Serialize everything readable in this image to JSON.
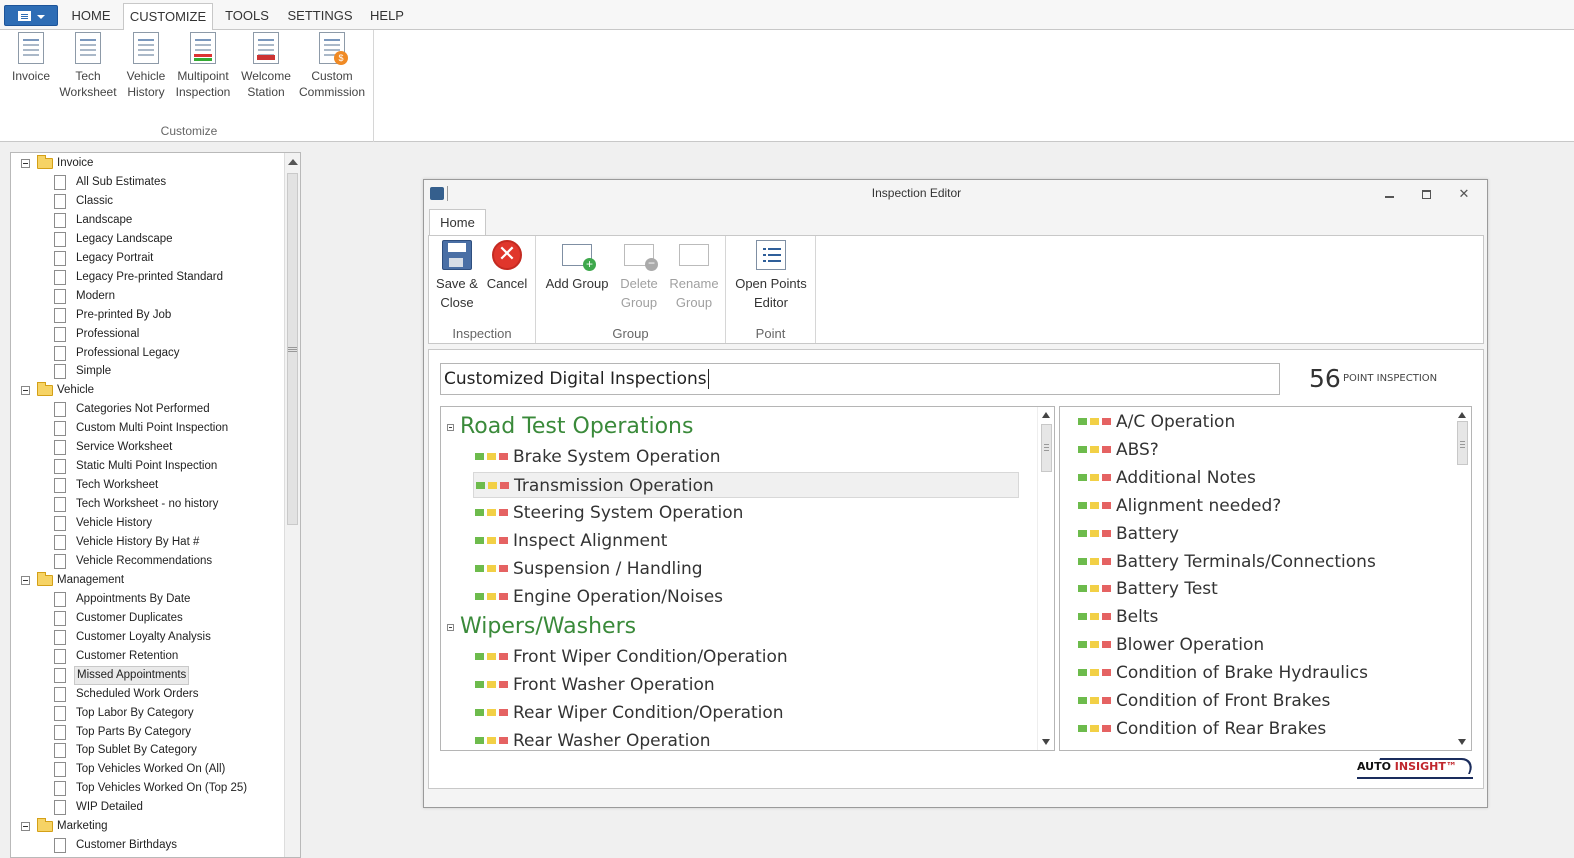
{
  "menubar": {
    "tabs": [
      "HOME",
      "CUSTOMIZE",
      "TOOLS",
      "SETTINGS",
      "HELP"
    ],
    "active_tab": "CUSTOMIZE"
  },
  "ribbon": {
    "group_label": "Customize",
    "buttons": [
      {
        "label": "Invoice",
        "icon": "invoice-doc-icon"
      },
      {
        "label": "Tech\nWorksheet",
        "icon": "worksheet-doc-icon"
      },
      {
        "label": "Vehicle\nHistory",
        "icon": "history-doc-icon"
      },
      {
        "label": "Multipoint\nInspection",
        "icon": "inspection-doc-icon"
      },
      {
        "label": "Welcome\nStation",
        "icon": "welcome-doc-icon"
      },
      {
        "label": "Custom\nCommission",
        "icon": "commission-doc-icon"
      }
    ]
  },
  "tree": {
    "rows": [
      {
        "type": "folder",
        "label": "Invoice"
      },
      {
        "type": "leaf",
        "label": "All Sub Estimates"
      },
      {
        "type": "leaf",
        "label": "Classic"
      },
      {
        "type": "leaf",
        "label": "Landscape"
      },
      {
        "type": "leaf",
        "label": "Legacy Landscape"
      },
      {
        "type": "leaf",
        "label": "Legacy Portrait"
      },
      {
        "type": "leaf",
        "label": "Legacy Pre-printed Standard"
      },
      {
        "type": "leaf",
        "label": "Modern"
      },
      {
        "type": "leaf",
        "label": "Pre-printed By Job"
      },
      {
        "type": "leaf",
        "label": "Professional"
      },
      {
        "type": "leaf",
        "label": "Professional Legacy"
      },
      {
        "type": "leaf",
        "label": "Simple"
      },
      {
        "type": "folder",
        "label": "Vehicle"
      },
      {
        "type": "leaf",
        "label": "Categories Not Performed"
      },
      {
        "type": "leaf",
        "label": "Custom Multi Point Inspection"
      },
      {
        "type": "leaf",
        "label": "Service Worksheet"
      },
      {
        "type": "leaf",
        "label": "Static Multi Point Inspection"
      },
      {
        "type": "leaf",
        "label": "Tech Worksheet"
      },
      {
        "type": "leaf",
        "label": "Tech Worksheet - no history"
      },
      {
        "type": "leaf",
        "label": "Vehicle History"
      },
      {
        "type": "leaf",
        "label": "Vehicle History By Hat #"
      },
      {
        "type": "leaf",
        "label": "Vehicle Recommendations"
      },
      {
        "type": "folder",
        "label": "Management"
      },
      {
        "type": "leaf",
        "label": "Appointments By Date"
      },
      {
        "type": "leaf",
        "label": "Customer Duplicates"
      },
      {
        "type": "leaf",
        "label": "Customer Loyalty Analysis"
      },
      {
        "type": "leaf",
        "label": "Customer Retention"
      },
      {
        "type": "leaf",
        "label": "Missed Appointments",
        "selected": true
      },
      {
        "type": "leaf",
        "label": "Scheduled Work Orders"
      },
      {
        "type": "leaf",
        "label": "Top Labor By Category"
      },
      {
        "type": "leaf",
        "label": "Top Parts By Category"
      },
      {
        "type": "leaf",
        "label": "Top Sublet By Category"
      },
      {
        "type": "leaf",
        "label": "Top Vehicles Worked On (All)"
      },
      {
        "type": "leaf",
        "label": "Top Vehicles Worked On (Top 25)"
      },
      {
        "type": "leaf",
        "label": "WIP Detailed"
      },
      {
        "type": "folder",
        "label": "Marketing"
      },
      {
        "type": "leaf",
        "label": "Customer Birthdays"
      }
    ]
  },
  "editor": {
    "title": "Inspection Editor",
    "tab": "Home",
    "groups": {
      "inspection": {
        "label": "Inspection",
        "save": "Save &\nClose",
        "cancel": "Cancel"
      },
      "group": {
        "label": "Group",
        "add": "Add Group",
        "delete": "Delete\nGroup",
        "rename": "Rename\nGroup"
      },
      "point": {
        "label": "Point",
        "open": "Open Points\nEditor"
      }
    },
    "name_value": "Customized Digital Inspections",
    "point_count": "56",
    "point_label": "POINT INSPECTION",
    "left_list": [
      {
        "type": "group",
        "label": "Road Test Operations"
      },
      {
        "type": "item",
        "label": "Brake System Operation"
      },
      {
        "type": "item",
        "label": "Transmission Operation",
        "selected": true
      },
      {
        "type": "item",
        "label": "Steering System Operation"
      },
      {
        "type": "item",
        "label": "Inspect Alignment"
      },
      {
        "type": "item",
        "label": "Suspension / Handling"
      },
      {
        "type": "item",
        "label": "Engine Operation/Noises"
      },
      {
        "type": "group",
        "label": "Wipers/Washers"
      },
      {
        "type": "item",
        "label": "Front Wiper Condition/Operation"
      },
      {
        "type": "item",
        "label": "Front Washer Operation"
      },
      {
        "type": "item",
        "label": "Rear Wiper Condition/Operation"
      },
      {
        "type": "item",
        "label": "Rear Washer Operation"
      }
    ],
    "right_list": [
      "A/C Operation",
      "ABS?",
      "Additional Notes",
      "Alignment needed?",
      "Battery",
      "Battery Terminals/Connections",
      "Battery Test",
      "Belts",
      "Blower Operation",
      "Condition of Brake Hydraulics",
      "Condition of Front Brakes",
      "Condition of Rear Brakes"
    ],
    "logo": {
      "text_a": "AUTO ",
      "text_b": "INSIGHT™"
    }
  }
}
